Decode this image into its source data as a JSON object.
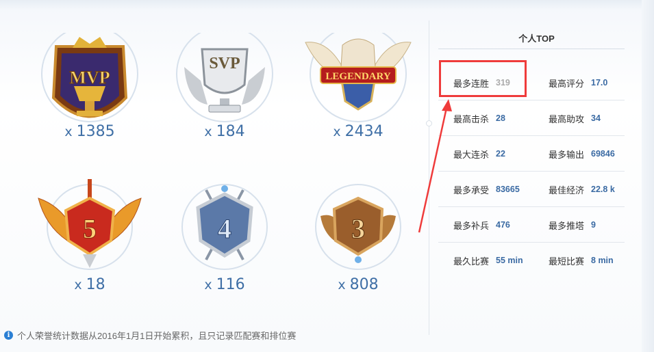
{
  "badges": [
    {
      "name": "MVP",
      "emblem": "MVP",
      "count": "1385"
    },
    {
      "name": "SVP",
      "emblem": "SVP",
      "count": "184"
    },
    {
      "name": "Legendary",
      "emblem": "LEGENDARY",
      "count": "2434"
    },
    {
      "name": "Penta",
      "emblem": "5",
      "count": "18"
    },
    {
      "name": "Quadra",
      "emblem": "4",
      "count": "116"
    },
    {
      "name": "Triple",
      "emblem": "3",
      "count": "808"
    }
  ],
  "x_prefix": "x",
  "top": {
    "title": "个人TOP",
    "rows": [
      [
        {
          "label": "最多连胜",
          "value": "319"
        },
        {
          "label": "最高评分",
          "value": "17.0"
        }
      ],
      [
        {
          "label": "最高击杀",
          "value": "28"
        },
        {
          "label": "最高助攻",
          "value": "34"
        }
      ],
      [
        {
          "label": "最大连杀",
          "value": "22"
        },
        {
          "label": "最多输出",
          "value": "69846"
        }
      ],
      [
        {
          "label": "最多承受",
          "value": "83665"
        },
        {
          "label": "最佳经济",
          "value": "22.8 k"
        }
      ],
      [
        {
          "label": "最多补兵",
          "value": "476"
        },
        {
          "label": "最多推塔",
          "value": "9"
        }
      ],
      [
        {
          "label": "最久比赛",
          "value": "55 min"
        },
        {
          "label": "最短比赛",
          "value": "8 min"
        }
      ]
    ]
  },
  "note": "个人荣誉统计数据从2016年1月1日开始累积，且只记录匹配赛和排位赛",
  "note_icon": "info-icon",
  "colors": {
    "highlight": "#ef3b3b",
    "value": "#3a6aa3",
    "count": "#3f6fa6"
  }
}
